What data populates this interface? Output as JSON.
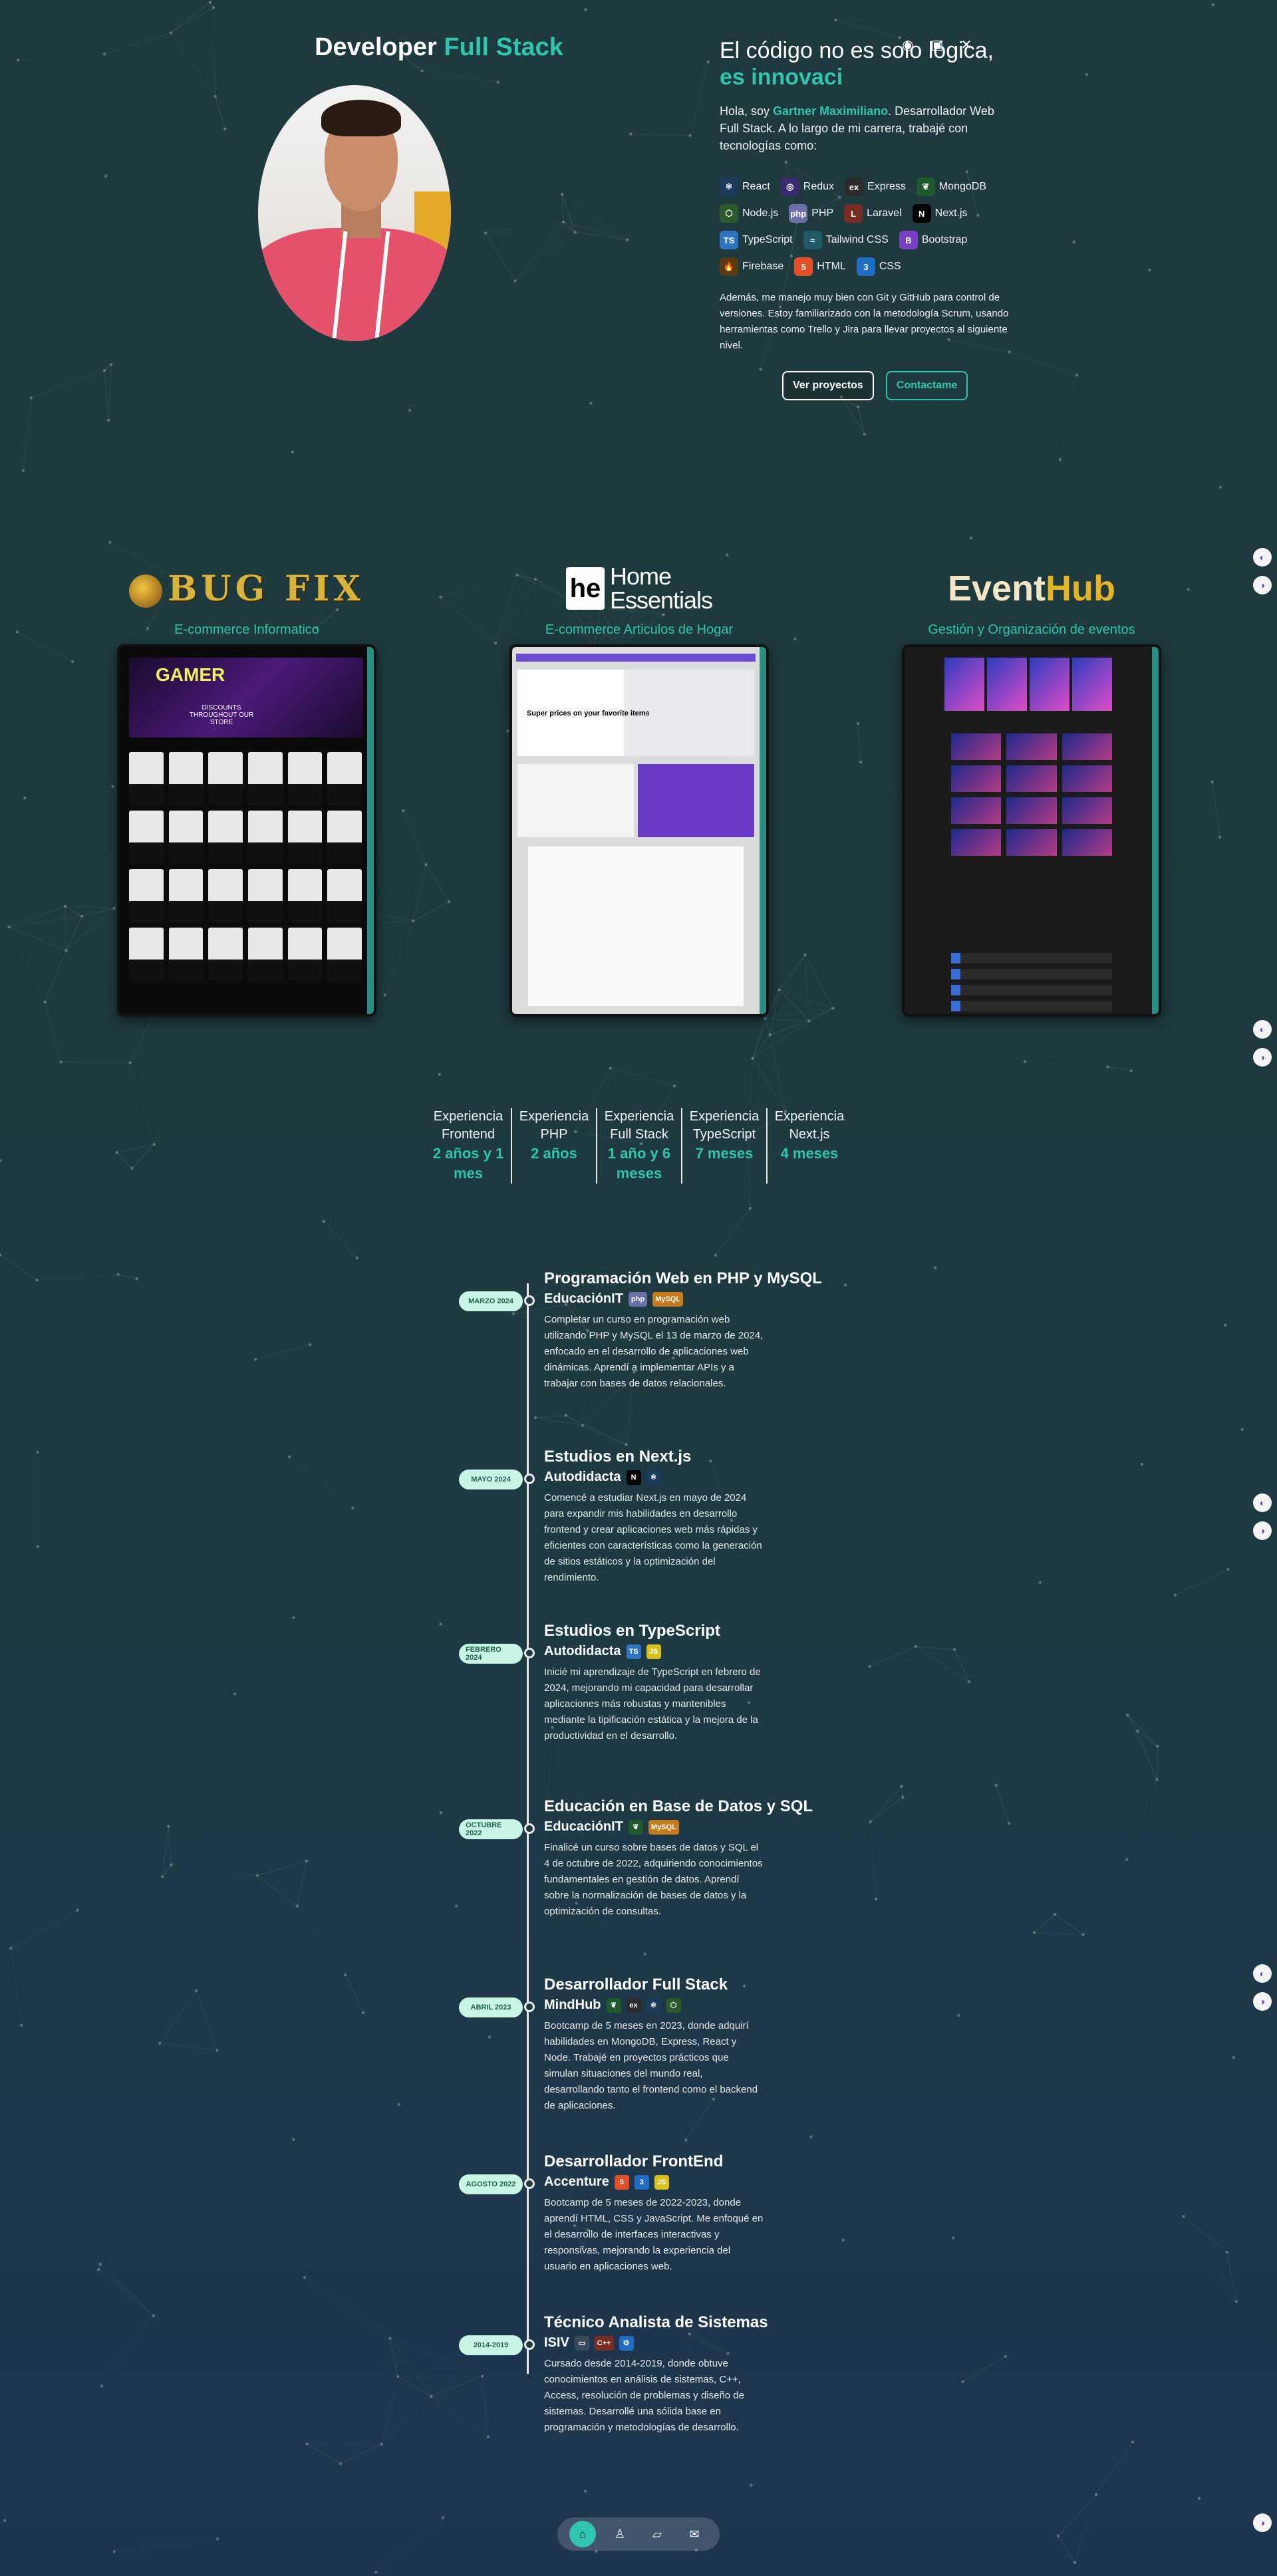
{
  "colors": {
    "accent": "#2fc5ae",
    "background": "#1e3a3d",
    "date_pill": "#c9f5e6"
  },
  "hero": {
    "title_prefix": "Developer",
    "title_accent": "Full Stack",
    "heading_line1": "El código no es solo lógica,",
    "heading_line2": "es innovaci",
    "intro_pre": "Hola, soy ",
    "intro_name": "Gartner Maximiliano",
    "intro_post": ". Desarrollador Web Full Stack. A lo largo de mi carrera, trabajé con tecnologías como:",
    "techs": [
      {
        "label": "React",
        "icon": "react-icon",
        "color": "#1a3b5c",
        "glyph": "⚛"
      },
      {
        "label": "Redux",
        "icon": "redux-icon",
        "color": "#3b2a6e",
        "glyph": "◎"
      },
      {
        "label": "Express",
        "icon": "express-icon",
        "color": "#2b2b2b",
        "glyph": "ex"
      },
      {
        "label": "MongoDB",
        "icon": "mongodb-icon",
        "color": "#1f5a2c",
        "glyph": "❦"
      },
      {
        "label": "Node.js",
        "icon": "nodejs-icon",
        "color": "#2d5a2d",
        "glyph": "⬡"
      },
      {
        "label": "PHP",
        "icon": "php-icon",
        "color": "#6a6fa8",
        "glyph": "php"
      },
      {
        "label": "Laravel",
        "icon": "laravel-icon",
        "color": "#7a2b22",
        "glyph": "L"
      },
      {
        "label": "Next.js",
        "icon": "nextjs-icon",
        "color": "#000000",
        "glyph": "N"
      },
      {
        "label": "TypeScript",
        "icon": "typescript-icon",
        "color": "#2f74c0",
        "glyph": "TS"
      },
      {
        "label": "Tailwind CSS",
        "icon": "tailwind-icon",
        "color": "#1f5a66",
        "glyph": "≈"
      },
      {
        "label": "Bootstrap",
        "icon": "bootstrap-icon",
        "color": "#7a3ec4",
        "glyph": "B"
      },
      {
        "label": "Firebase",
        "icon": "firebase-icon",
        "color": "#5a3a14",
        "glyph": "🔥"
      },
      {
        "label": "HTML",
        "icon": "html-icon",
        "color": "#e34f26",
        "glyph": "5"
      },
      {
        "label": "CSS",
        "icon": "css-icon",
        "color": "#1f6ec4",
        "glyph": "3"
      }
    ],
    "extra_pre": "Además, me manejo muy bien con ",
    "extra_git": "Git",
    "extra_mid": " y ",
    "extra_github": "GitHub",
    "extra_post": " para control de versiones. Estoy familiarizado con la metodología Scrum, usando herramientas como Trello y Jira para llevar proyectos al siguiente nivel.",
    "btn_projects": "Ver proyectos",
    "btn_contact": "Contactame"
  },
  "projects": [
    {
      "logo_text": "BUG FIX",
      "subtitle": "E-commerce Informatico",
      "screenshot": {
        "banner": "GAMER",
        "banner_sub": "DISCOUNTS THROUGHOUT OUR STORE"
      }
    },
    {
      "logo_mark": "he",
      "logo_line1": "Home",
      "logo_line2": "Essentials",
      "subtitle": "E-commerce Articulos de Hogar",
      "screenshot": {
        "hero_text": "Super prices on your favorite items"
      }
    },
    {
      "logo_part1": "Event",
      "logo_part2": "Hub",
      "subtitle": "Gestión y Organización de eventos"
    }
  ],
  "stats": [
    {
      "label": "Experiencia Frontend",
      "value": "2 años y 1 mes"
    },
    {
      "label": "Experiencia PHP",
      "value": "2 años"
    },
    {
      "label": "Experiencia Full Stack",
      "value": "1 año y 6 meses"
    },
    {
      "label": "Experiencia TypeScript",
      "value": "7 meses"
    },
    {
      "label": "Experiencia Next.js",
      "value": "4 meses"
    }
  ],
  "timeline": [
    {
      "date": "MARZO 2024",
      "title": "Programación Web en PHP y MySQL",
      "org": "EducaciónIT",
      "chips": [
        {
          "glyph": "php",
          "color": "#6a6fa8"
        },
        {
          "glyph": "MySQL",
          "color": "#c77a1a"
        }
      ],
      "desc": "Completar un curso en programación web utilizando PHP y MySQL el 13 de marzo de 2024, enfocado en el desarrollo de aplicaciones web dinámicas. Aprendí a implementar APIs y a trabajar con bases de datos relacionales."
    },
    {
      "date": "MAYO 2024",
      "title": "Estudios en Next.js",
      "org": "Autodidacta",
      "chips": [
        {
          "glyph": "N",
          "color": "#000000"
        },
        {
          "glyph": "⚛",
          "color": "#1a3b5c"
        }
      ],
      "desc": "Comencé a estudiar Next.js en mayo de 2024 para expandir mis habilidades en desarrollo frontend y crear aplicaciones web más rápidas y eficientes con características como la generación de sitios estáticos y la optimización del rendimiento."
    },
    {
      "date": "FEBRERO 2024",
      "title": "Estudios en TypeScript",
      "org": "Autodidacta",
      "chips": [
        {
          "glyph": "TS",
          "color": "#2f74c0"
        },
        {
          "glyph": "JS",
          "color": "#d8c21a"
        }
      ],
      "desc": "Inicié mi aprendizaje de TypeScript en febrero de 2024, mejorando mi capacidad para desarrollar aplicaciones más robustas y mantenibles mediante la tipificación estática y la mejora de la productividad en el desarrollo."
    },
    {
      "date": "OCTUBRE 2022",
      "title": "Educación en Base de Datos y SQL",
      "org": "EducaciónIT",
      "chips": [
        {
          "glyph": "❦",
          "color": "#1f5a2c"
        },
        {
          "glyph": "MySQL",
          "color": "#c77a1a"
        }
      ],
      "desc": "Finalicé un curso sobre bases de datos y SQL el 4 de octubre de 2022, adquiriendo conocimientos fundamentales en gestión de datos. Aprendí sobre la normalización de bases de datos y la optimización de consultas."
    },
    {
      "date": "ABRIL 2023",
      "title": "Desarrollador Full Stack",
      "org": "MindHub",
      "chips": [
        {
          "glyph": "❦",
          "color": "#1f5a2c"
        },
        {
          "glyph": "ex",
          "color": "#2b2b2b"
        },
        {
          "glyph": "⚛",
          "color": "#1a3b5c"
        },
        {
          "glyph": "⬡",
          "color": "#2d5a2d"
        }
      ],
      "desc": "Bootcamp de 5 meses en 2023, donde adquirí habilidades en MongoDB, Express, React y Node. Trabajé en proyectos prácticos que simulan situaciones del mundo real, desarrollando tanto el frontend como el backend de aplicaciones."
    },
    {
      "date": "AGOSTO 2022",
      "title": "Desarrollador FrontEnd",
      "org": "Accenture",
      "chips": [
        {
          "glyph": "5",
          "color": "#e34f26"
        },
        {
          "glyph": "3",
          "color": "#1f6ec4"
        },
        {
          "glyph": "JS",
          "color": "#d8c21a"
        }
      ],
      "desc": "Bootcamp de 5 meses de 2022-2023, donde aprendí HTML, CSS y JavaScript. Me enfoqué en el desarrollo de interfaces interactivas y responsivas, mejorando la experiencia del usuario en aplicaciones web."
    },
    {
      "date": "2014-2019",
      "title": "Técnico Analista de Sistemas",
      "org": "ISIV",
      "chips": [
        {
          "glyph": "▭",
          "color": "#3a4a5a"
        },
        {
          "glyph": "C++",
          "color": "#7a2b22"
        },
        {
          "glyph": "⚙",
          "color": "#1f6ec4"
        }
      ],
      "desc": "Cursado desde 2014-2019, donde obtuve conocimientos en análisis de sistemas, C++, Access, resolución de problemas y diseño de sistemas. Desarrollé una sólida base en programación y metodologías de desarrollo."
    }
  ],
  "nav": [
    {
      "icon": "home-icon",
      "glyph": "⌂"
    },
    {
      "icon": "user-icon",
      "glyph": "♙"
    },
    {
      "icon": "folder-icon",
      "glyph": "▱"
    },
    {
      "icon": "mail-icon",
      "glyph": "✉"
    }
  ]
}
